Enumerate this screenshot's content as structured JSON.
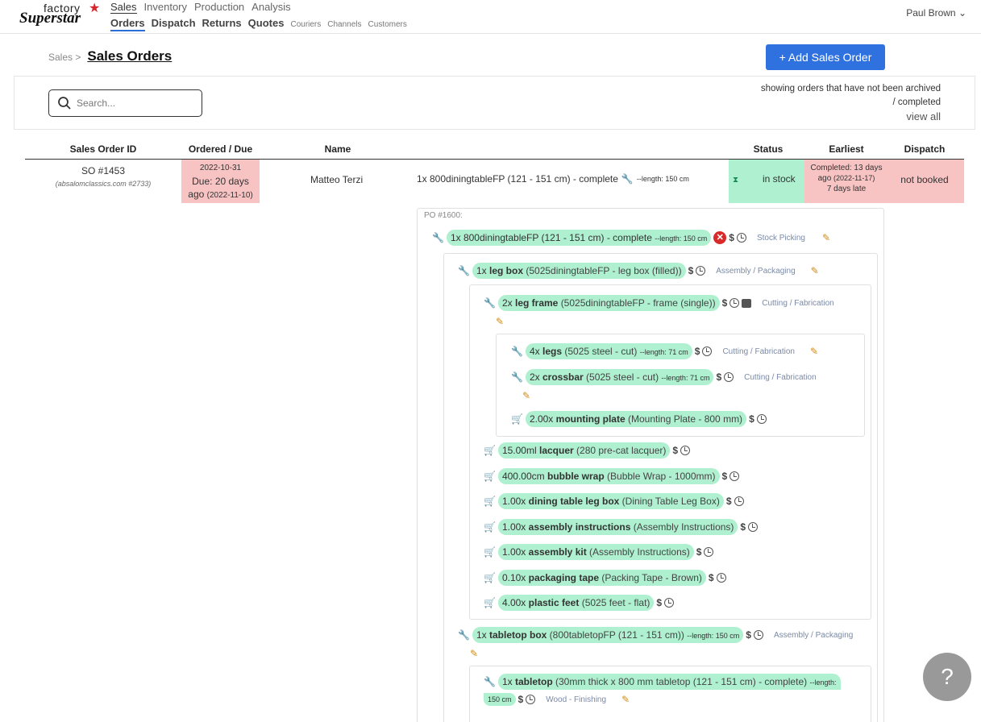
{
  "brand": {
    "line1": "factory",
    "line2": "Superstar",
    "star": "★"
  },
  "nav": {
    "main": [
      "Sales",
      "Inventory",
      "Production",
      "Analysis"
    ],
    "sub_big": [
      "Orders",
      "Dispatch",
      "Returns",
      "Quotes"
    ],
    "sub_small": [
      "Couriers",
      "Channels",
      "Customers"
    ],
    "user": "Paul Brown",
    "user_caret": "⌄"
  },
  "header": {
    "crumb": "Sales >",
    "title": "Sales Orders",
    "add_button": "+ Add Sales Order"
  },
  "filter": {
    "search_placeholder": "Search...",
    "showing_line1": "showing orders that have not been archived",
    "showing_line2": "/ completed",
    "view_all": "view all"
  },
  "table": {
    "headers": [
      "Sales Order ID",
      "Ordered / Due",
      "Name",
      "Status",
      "Earliest",
      "Dispatch"
    ],
    "row": {
      "id": "SO #1453",
      "channel": "(absalomclassics.com #2733)",
      "ordered": "2022-10-31",
      "due": "Due: 20 days",
      "due_ago": "ago",
      "due_date": "(2022-11-10)",
      "name": "Matteo Terzi",
      "item": "1x 800diningtableFP (121 - 151 cm) - complete",
      "item_len": "--length: 150 cm",
      "status": "in stock",
      "earliest_1": "Completed: 13 days",
      "earliest_2": "ago",
      "earliest_2b": "(2022-11-17)",
      "earliest_3": "7 days late",
      "dispatch": "not booked"
    }
  },
  "tree": {
    "po": "PO #1600:",
    "root": {
      "qty": "1x 800diningtableFP (121 - 151 cm) - complete",
      "len": "--length: 150 cm",
      "proc": "Stock Picking"
    },
    "legbox": {
      "qty": "1x",
      "name": "leg box",
      "desc": "(5025diningtableFP - leg box (filled))",
      "proc": "Assembly / Packaging"
    },
    "legframe": {
      "qty": "2x",
      "name": "leg frame",
      "desc": "(5025diningtableFP - frame (single))",
      "proc": "Cutting / Fabrication"
    },
    "legs": {
      "qty": "4x",
      "name": "legs",
      "desc": "(5025 steel - cut)",
      "len": "--length: 71 cm",
      "proc": "Cutting / Fabrication"
    },
    "crossbar": {
      "qty": "2x",
      "name": "crossbar",
      "desc": "(5025 steel - cut)",
      "len": "--length: 71 cm",
      "proc": "Cutting / Fabrication"
    },
    "mountingplate": {
      "qty": "2.00x",
      "name": "mounting plate",
      "desc": "(Mounting Plate - 800 mm)"
    },
    "lacquer": {
      "qty": "15.00ml",
      "name": "lacquer",
      "desc": "(280 pre-cat lacquer)"
    },
    "bubblewrap": {
      "qty": "400.00cm",
      "name": "bubble wrap",
      "desc": "(Bubble Wrap - 1000mm)"
    },
    "diningbox": {
      "qty": "1.00x",
      "name": "dining table leg box",
      "desc": "(Dining Table Leg Box)"
    },
    "instructions": {
      "qty": "1.00x",
      "name": "assembly instructions",
      "desc": "(Assembly Instructions)"
    },
    "kit": {
      "qty": "1.00x",
      "name": "assembly kit",
      "desc": "(Assembly Instructions)"
    },
    "tape": {
      "qty": "0.10x",
      "name": "packaging tape",
      "desc": "(Packing Tape - Brown)"
    },
    "feet": {
      "qty": "4.00x",
      "name": "plastic feet",
      "desc": "(5025 feet - flat)"
    },
    "tabletopbox": {
      "qty": "1x",
      "name": "tabletop box",
      "desc": "(800tabletopFP (121 - 151 cm))",
      "len": "--length: 150 cm",
      "proc": "Assembly / Packaging"
    },
    "tabletop": {
      "qty": "1x",
      "name": "tabletop",
      "desc": "(30mm thick x 800 mm tabletop (121 - 151 cm) - complete)",
      "len_a": "--length:",
      "len_b": "150 cm",
      "proc": "Wood - Finishing"
    }
  },
  "help": "?"
}
